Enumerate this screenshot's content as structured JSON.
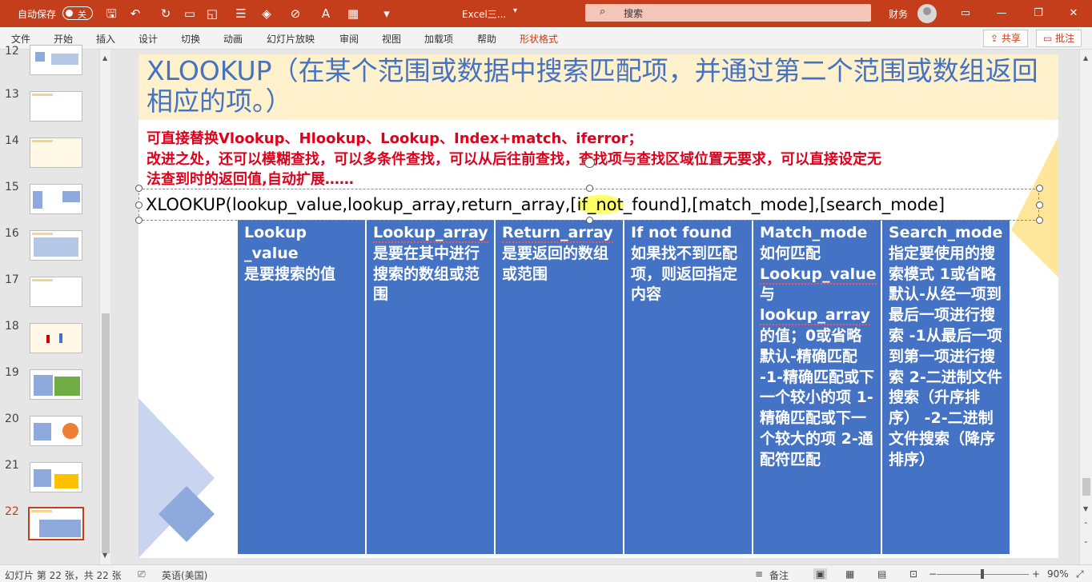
{
  "titlebar": {
    "autosave_label": "自动保存",
    "autosave_state": "关",
    "doc_title": "Excel三...",
    "search_placeholder": "搜索",
    "user": "财务"
  },
  "ribbon": {
    "tabs": [
      "文件",
      "开始",
      "插入",
      "设计",
      "切换",
      "动画",
      "幻灯片放映",
      "审阅",
      "视图",
      "加载项",
      "帮助",
      "形状格式"
    ],
    "share_label": "共享",
    "comment_label": "批注"
  },
  "thumbnails": {
    "numbers": [
      "12",
      "13",
      "14",
      "15",
      "16",
      "17",
      "18",
      "19",
      "20",
      "21",
      "22"
    ],
    "active": "22"
  },
  "slide": {
    "title": "XLOOKUP（在某个范围或数据中搜索匹配项，并通过第二个范围或数组返回相应的项。）",
    "red_line1": "可直接替换Vlookup、Hlookup、Lookup、Index+match、iferror；",
    "red_line2": "改进之处，还可以模糊查找，可以多条件查找，可以从后往前查找，查找项与查找区域位置无要求，可以直接设定无",
    "red_line3": "法查到时的返回值,自动扩展……",
    "formula_prefix": "XLOOKUP(lookup_value,lookup_array,return_array,[",
    "formula_hl": "if_not",
    "formula_suffix": "_found],[match_mode],[search_mode]",
    "columns": [
      {
        "head": "Lookup _value",
        "body": "是要搜索的值"
      },
      {
        "head": "Lookup_array",
        "body": "是要在其中进行搜索的数组或范围"
      },
      {
        "head": "Return_array",
        "body": "是要返回的数组或范围"
      },
      {
        "head": "If not found如果找不到匹配项，则返回指定内容",
        "body": ""
      },
      {
        "head": "Match_mode",
        "body1": "如何匹配",
        "u1": "Lookup_value",
        "body2": "与",
        "u2": "lookup_array",
        "body3": "的值；0或省略默认-精确匹配 -1-精确匹配或下一个较小的项 1-精确匹配或下一个较大的项 2-通配符匹配"
      },
      {
        "head": "Search_mode",
        "body": "指定要使用的搜索模式 1或省略默认-从经一项到最后一项进行搜索 -1从最后一项到第一项进行搜索 2-二进制文件搜索（升序排序） -2-二进制文件搜索（降序排序）"
      }
    ]
  },
  "statusbar": {
    "slide_info": "幻灯片 第 22 张，共 22 张",
    "language": "英语(美国)",
    "notes": "备注",
    "zoom": "90%"
  },
  "colors": {
    "titlebar": "#c43e1c",
    "column_fill": "#4472c4",
    "title_text": "#4472c4",
    "red_text": "#e0001b",
    "title_band": "#fff1cc"
  }
}
